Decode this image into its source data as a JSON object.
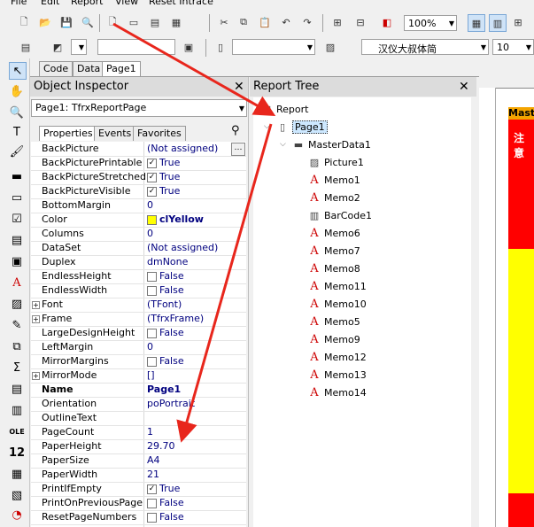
{
  "menu": [
    "File",
    "Edit",
    "Report",
    "View",
    "Reset Intrace"
  ],
  "toolbar": {
    "zoom": "100%",
    "font_name": "汉仪大叔体简",
    "font_size": "10"
  },
  "doc_tabs": [
    "Code",
    "Data",
    "Page1"
  ],
  "inspector": {
    "title": "Object Inspector",
    "object_selector": "Page1: TfrxReportPage",
    "tabs": [
      "Properties",
      "Events",
      "Favorites"
    ],
    "properties": [
      {
        "name": "BackPicture",
        "value": "(Not assigned)",
        "type": "ellipsis"
      },
      {
        "name": "BackPicturePrintable",
        "value": "True",
        "type": "check",
        "checked": true
      },
      {
        "name": "BackPictureStretched",
        "value": "True",
        "type": "check",
        "checked": true
      },
      {
        "name": "BackPictureVisible",
        "value": "True",
        "type": "check",
        "checked": true
      },
      {
        "name": "BottomMargin",
        "value": "0"
      },
      {
        "name": "Color",
        "value": "clYellow",
        "type": "color",
        "swatch": "#ffff00",
        "bold": true
      },
      {
        "name": "Columns",
        "value": "0"
      },
      {
        "name": "DataSet",
        "value": "(Not assigned)"
      },
      {
        "name": "Duplex",
        "value": "dmNone"
      },
      {
        "name": "EndlessHeight",
        "value": "False",
        "type": "check",
        "checked": false
      },
      {
        "name": "EndlessWidth",
        "value": "False",
        "type": "check",
        "checked": false
      },
      {
        "name": "Font",
        "value": "(TFont)",
        "expand": true
      },
      {
        "name": "Frame",
        "value": "(TfrxFrame)",
        "expand": true
      },
      {
        "name": "LargeDesignHeight",
        "value": "False",
        "type": "check",
        "checked": false
      },
      {
        "name": "LeftMargin",
        "value": "0"
      },
      {
        "name": "MirrorMargins",
        "value": "False",
        "type": "check",
        "checked": false
      },
      {
        "name": "MirrorMode",
        "value": "[]",
        "expand": true
      },
      {
        "name": "Name",
        "value": "Page1",
        "bold": true,
        "namebold": true
      },
      {
        "name": "Orientation",
        "value": "poPortrait"
      },
      {
        "name": "OutlineText",
        "value": ""
      },
      {
        "name": "PageCount",
        "value": "1"
      },
      {
        "name": "PaperHeight",
        "value": "29.70"
      },
      {
        "name": "PaperSize",
        "value": "A4"
      },
      {
        "name": "PaperWidth",
        "value": "21"
      },
      {
        "name": "PrintIfEmpty",
        "value": "True",
        "type": "check",
        "checked": true
      },
      {
        "name": "PrintOnPreviousPage",
        "value": "False",
        "type": "check",
        "checked": false
      },
      {
        "name": "ResetPageNumbers",
        "value": "False",
        "type": "check",
        "checked": false
      }
    ]
  },
  "tree": {
    "title": "Report Tree",
    "nodes": [
      {
        "label": "Report",
        "icon": "report-icon",
        "level": 0
      },
      {
        "label": "Page1",
        "icon": "page-icon",
        "level": 1,
        "selected": true
      },
      {
        "label": "MasterData1",
        "icon": "band-icon",
        "level": 2
      },
      {
        "label": "Picture1",
        "icon": "picture-icon",
        "level": 3
      },
      {
        "label": "Memo1",
        "icon": "memo-icon",
        "level": 3
      },
      {
        "label": "Memo2",
        "icon": "memo-icon",
        "level": 3
      },
      {
        "label": "BarCode1",
        "icon": "barcode-icon",
        "level": 3
      },
      {
        "label": "Memo6",
        "icon": "memo-icon",
        "level": 3
      },
      {
        "label": "Memo7",
        "icon": "memo-icon",
        "level": 3
      },
      {
        "label": "Memo8",
        "icon": "memo-icon",
        "level": 3
      },
      {
        "label": "Memo11",
        "icon": "memo-icon",
        "level": 3
      },
      {
        "label": "Memo10",
        "icon": "memo-icon",
        "level": 3
      },
      {
        "label": "Memo5",
        "icon": "memo-icon",
        "level": 3
      },
      {
        "label": "Memo9",
        "icon": "memo-icon",
        "level": 3
      },
      {
        "label": "Memo12",
        "icon": "memo-icon",
        "level": 3
      },
      {
        "label": "Memo13",
        "icon": "memo-icon",
        "level": 3
      },
      {
        "label": "Memo14",
        "icon": "memo-icon",
        "level": 3
      }
    ]
  },
  "preview": {
    "band_label": "Mast",
    "red_text": "注意"
  },
  "colors": {
    "accent_red": "#e8261c",
    "page_yellow": "#ffff00",
    "band_red": "#ff0000"
  }
}
